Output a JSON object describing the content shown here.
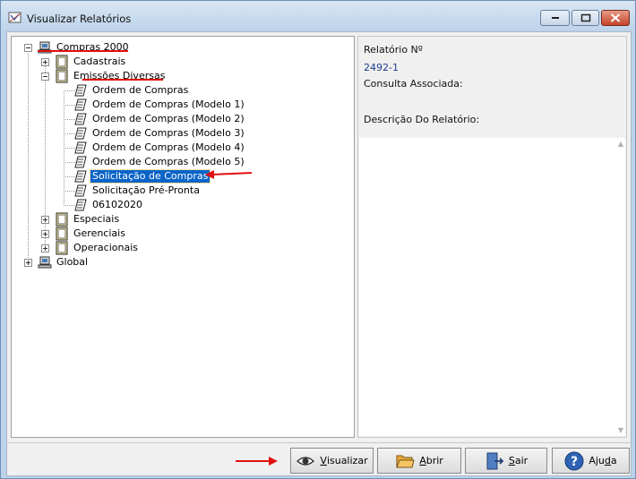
{
  "window": {
    "title": "Visualizar Relatórios",
    "controls": {
      "minimize": "minimize",
      "maximize": "maximize",
      "close": "close"
    }
  },
  "tree": {
    "root1": {
      "label": "Compras 2000",
      "icon": "computer-icon",
      "expanded": true
    },
    "cadastrais": {
      "label": "Cadastrais",
      "icon": "folder-doc-icon",
      "expanded": false
    },
    "emissoes": {
      "label": "Emissões Diversas",
      "icon": "folder-doc-icon",
      "expanded": true
    },
    "reports": [
      {
        "label": "Ordem de Compras"
      },
      {
        "label": "Ordem de Compras (Modelo 1)"
      },
      {
        "label": "Ordem de Compras (Modelo 2)"
      },
      {
        "label": "Ordem de Compras (Modelo 3)"
      },
      {
        "label": "Ordem de Compras (Modelo 4)"
      },
      {
        "label": "Ordem de Compras (Modelo 5)"
      },
      {
        "label": "Solicitação de Compras",
        "selected": true
      },
      {
        "label": "Solicitação Pré-Pronta"
      },
      {
        "label": "06102020"
      }
    ],
    "especiais": {
      "label": "Especiais",
      "icon": "folder-doc-icon",
      "expanded": false
    },
    "gerenciais": {
      "label": "Gerenciais",
      "icon": "folder-doc-icon",
      "expanded": false
    },
    "operacionais": {
      "label": "Operacionais",
      "icon": "folder-doc-icon",
      "expanded": false
    },
    "root2": {
      "label": "Global",
      "icon": "computer-icon",
      "expanded": false
    }
  },
  "info": {
    "report_number_label": "Relatório Nº",
    "report_number_value": "2492-1",
    "query_label": "Consulta Associada:",
    "query_value": "",
    "description_label": "Descrição Do Relatório:",
    "description_value": ""
  },
  "buttons": {
    "visualizar": {
      "pre": "",
      "accel": "V",
      "post": "isualizar",
      "icon": "eye-icon"
    },
    "abrir": {
      "pre": "",
      "accel": "A",
      "post": "brir",
      "icon": "folder-icon"
    },
    "sair": {
      "pre": "",
      "accel": "S",
      "post": "air",
      "icon": "exit-door-icon"
    },
    "ajuda": {
      "pre": "Aju",
      "accel": "d",
      "post": "a",
      "icon": "help-icon"
    }
  },
  "colors": {
    "selection": "#0a64c8",
    "annotation": "#e01010",
    "link_value": "#1a3c8a"
  }
}
